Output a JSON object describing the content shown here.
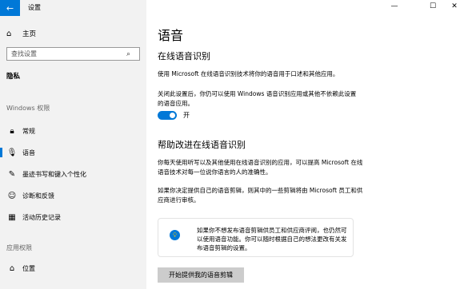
{
  "app": {
    "title": "设置",
    "back_icon": "arrow-left-icon"
  },
  "window": {
    "minimize_glyph": "—",
    "maximize_glyph": "☐",
    "close_glyph": "✕"
  },
  "sidebar": {
    "home_label": "主页",
    "search_placeholder": "查找设置",
    "category": "隐私",
    "windows_permissions_label": "Windows 权限",
    "windows_items": [
      {
        "label": "常规",
        "icon": "lock-icon"
      },
      {
        "label": "语音",
        "icon": "microphone-icon",
        "active": true
      },
      {
        "label": "墨迹书写和键入个性化",
        "icon": "pen-icon"
      },
      {
        "label": "诊断和反馈",
        "icon": "feedback-icon"
      },
      {
        "label": "活动历史记录",
        "icon": "activity-icon"
      }
    ],
    "app_permissions_label": "应用权限",
    "app_items": [
      {
        "label": "位置",
        "icon": "location-icon"
      }
    ]
  },
  "main": {
    "title": "语音",
    "online_heading": "在线语音识别",
    "online_desc": "使用 Microsoft 在线语音识别技术将你的语音用于口述和其他应用。",
    "off_desc": "关闭此设置后，你仍可以使用 Windows 语音识别应用或其他不依赖此设置的语音应用。",
    "toggle_state": "开",
    "improve_heading": "帮助改进在线语音识别",
    "improve_desc": "你每天使用听写以及其他使用在线语音识别的应用，可以提高 Microsoft 在线语音技术对每一位说你语言的人的准确性。",
    "share_desc": "如果你决定提供自己的语音剪辑，则其中的一些剪辑将由 Microsoft 员工和供应商进行审核。",
    "info_text": "如果你不想发布语音剪辑供员工和供应商评阅，也仍然可以使用语音功能。你可以随时根据自己的想法更改有关发布语音剪辑的设置。",
    "button_label": "开始提供我的语音剪辑"
  },
  "colors": {
    "accent": "#0078d7",
    "sidebar_bg": "#f2f2f2"
  }
}
